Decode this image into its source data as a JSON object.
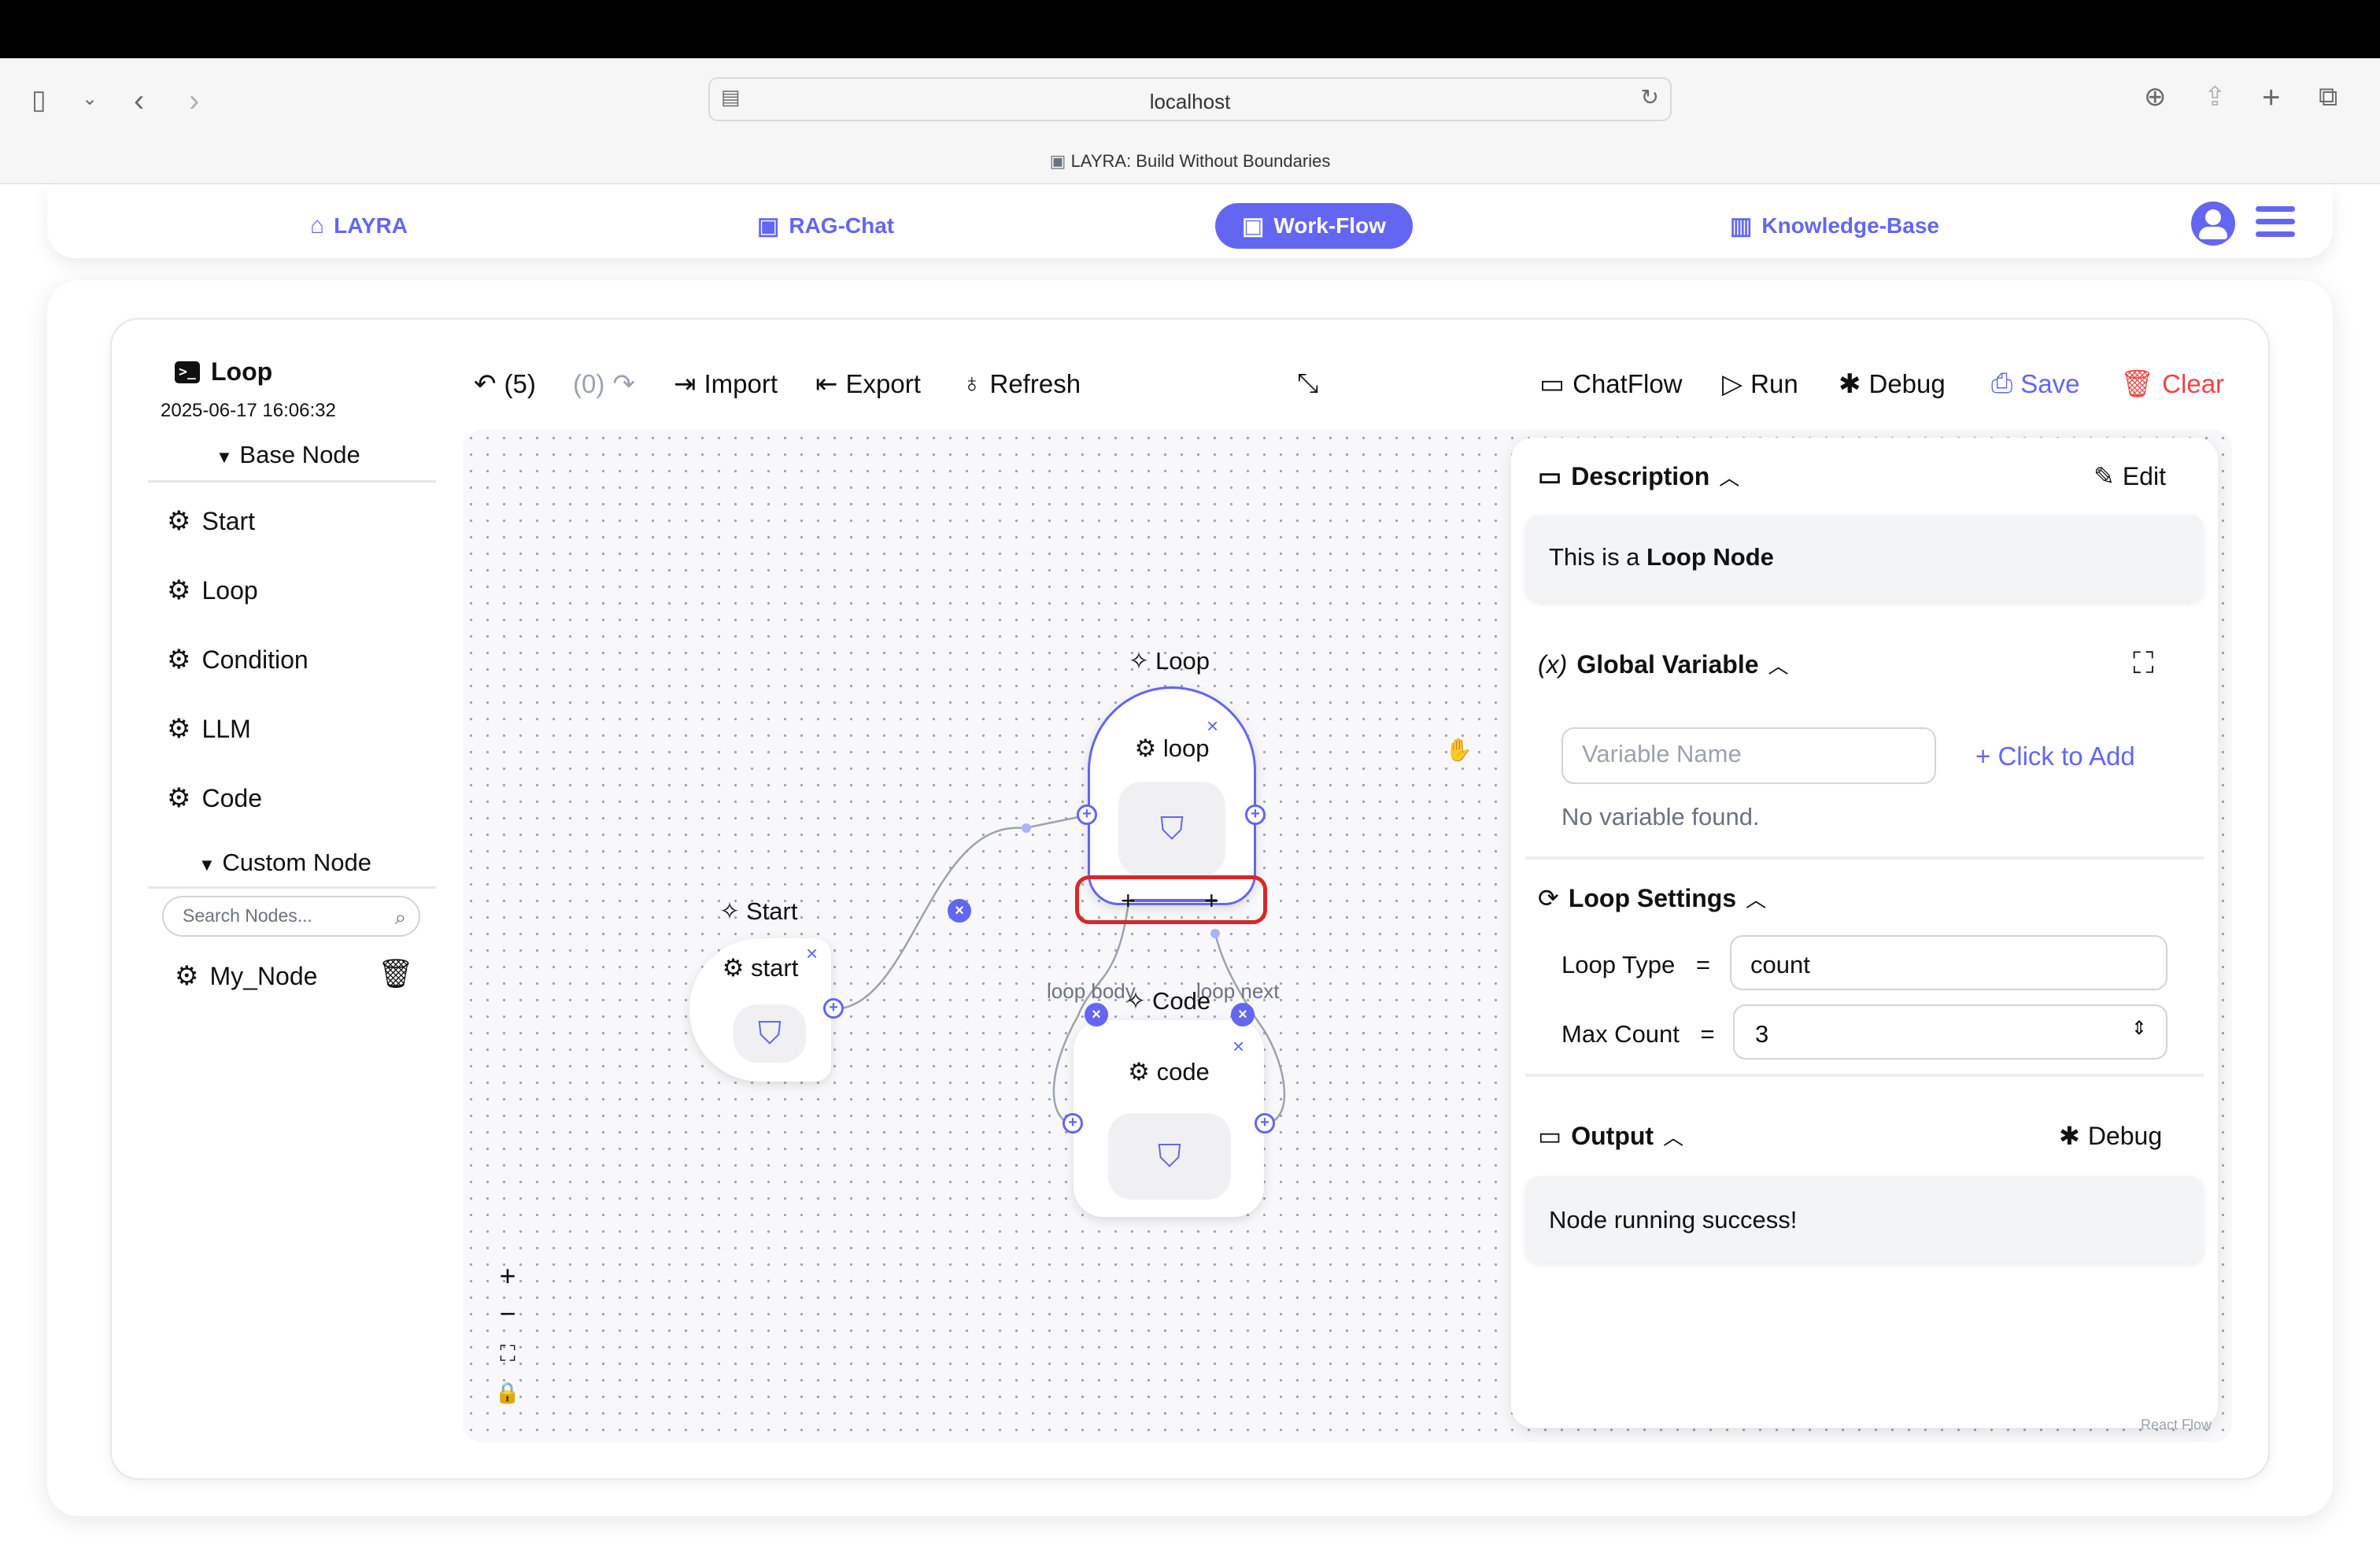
{
  "browser": {
    "url": "localhost",
    "tab_title": "LAYRA: Build Without Boundaries"
  },
  "nav": {
    "items": [
      {
        "label": "LAYRA",
        "icon": "home-icon"
      },
      {
        "label": "RAG-Chat",
        "icon": "chat-icon"
      },
      {
        "label": "Work-Flow",
        "icon": "terminal-icon",
        "active": true
      },
      {
        "label": "Knowledge-Base",
        "icon": "book-icon"
      }
    ]
  },
  "workflow": {
    "name": "Loop",
    "timestamp": "2025-06-17 16:06:32"
  },
  "sidebar": {
    "base_header": "Base Node",
    "base_nodes": [
      "Start",
      "Loop",
      "Condition",
      "LLM",
      "Code"
    ],
    "custom_header": "Custom Node",
    "search_placeholder": "Search Nodes...",
    "custom_nodes": [
      "My_Node"
    ]
  },
  "toolbar": {
    "undo": "(5)",
    "redo": "(0)",
    "import": "Import",
    "export": "Export",
    "refresh": "Refresh",
    "chatflow": "ChatFlow",
    "run": "Run",
    "debug": "Debug",
    "save": "Save",
    "clear": "Clear"
  },
  "canvas": {
    "nodes": {
      "start": {
        "label": "Start",
        "name": "start"
      },
      "loop": {
        "label": "Loop",
        "name": "loop"
      },
      "code": {
        "label": "Code",
        "name": "code"
      }
    },
    "edge_labels": {
      "loop_body": "loop body",
      "loop_next": "loop next"
    },
    "watermark": "React Flow"
  },
  "panel": {
    "description": {
      "title": "Description",
      "edit": "Edit",
      "text_prefix": "This is a",
      "text_bold": "Loop Node"
    },
    "global_variable": {
      "title": "Global Variable",
      "placeholder": "Variable Name",
      "add": "+ Click to Add",
      "empty": "No variable found."
    },
    "loop_settings": {
      "title": "Loop Settings",
      "loop_type_label": "Loop Type",
      "loop_type_value": "count",
      "max_count_label": "Max Count",
      "max_count_value": "3",
      "equals": "="
    },
    "output": {
      "title": "Output",
      "debug": "Debug",
      "text": "Node running success!"
    }
  },
  "colors": {
    "accent": "#6366f1",
    "danger": "#ef4444",
    "highlight_box": "#dc2626"
  }
}
